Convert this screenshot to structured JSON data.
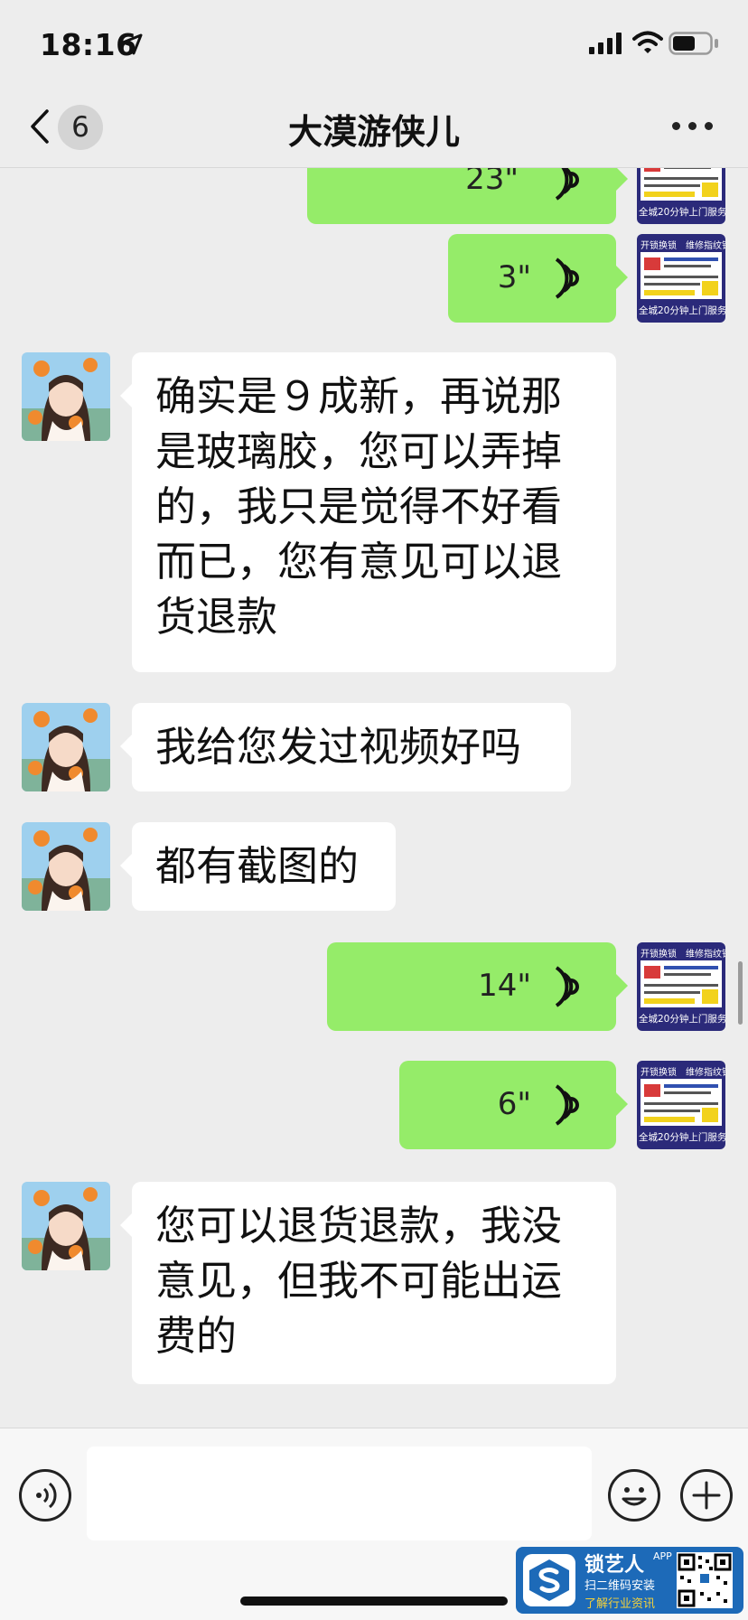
{
  "status_bar": {
    "time": "18:16"
  },
  "nav": {
    "unread_count": "6",
    "title": "大漠游侠儿"
  },
  "messages": [
    {
      "sender": "me",
      "type": "voice",
      "duration": "23\""
    },
    {
      "sender": "me",
      "type": "voice",
      "duration": "3\""
    },
    {
      "sender": "other",
      "type": "text",
      "text": "确实是９成新，再说那是玻璃胶，您可以弄掉的，我只是觉得不好看而已，您有意见可以退货退款"
    },
    {
      "sender": "other",
      "type": "text",
      "text": "我给您发过视频好吗"
    },
    {
      "sender": "other",
      "type": "text",
      "text": "都有截图的"
    },
    {
      "sender": "me",
      "type": "voice",
      "duration": "14\""
    },
    {
      "sender": "me",
      "type": "voice",
      "duration": "6\""
    },
    {
      "sender": "other",
      "type": "text",
      "text": "您可以退货退款，我没意见，但我不可能出运费的"
    }
  ],
  "my_avatar": {
    "line1": "开锁换锁　维修指纹锁",
    "footer": "全城20分钟上门服务"
  },
  "watermark": {
    "name": "锁艺人",
    "app_tag": "APP",
    "line1": "扫二维码安装",
    "line2": "了解行业资讯"
  },
  "colors": {
    "my_bubble": "#95ec69",
    "their_bubble": "#ffffff",
    "background": "#ededed",
    "avatar_bg": "#2b2a7a"
  }
}
